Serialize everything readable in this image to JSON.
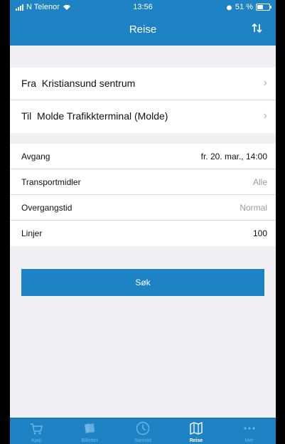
{
  "status_bar": {
    "carrier": "N Telenor",
    "time": "13:56",
    "battery": "51 %"
  },
  "nav": {
    "title": "Reise",
    "swap_icon": "swap-arrows-icon"
  },
  "route": {
    "from_prefix": "Fra",
    "from_value": "Kristiansund sentrum",
    "to_prefix": "Til",
    "to_value": "Molde Trafikkterminal (Molde)"
  },
  "options": [
    {
      "label": "Avgang",
      "value": "fr. 20. mar., 14:00"
    },
    {
      "label": "Transportmidler",
      "value": "Alle"
    },
    {
      "label": "Overgangstid",
      "value": "Normal"
    },
    {
      "label": "Linjer",
      "value": "100"
    }
  ],
  "search_button": "Søk",
  "tabs": [
    {
      "label": "Kjøp",
      "icon": "cart-icon"
    },
    {
      "label": "Billetter",
      "icon": "tickets-icon"
    },
    {
      "label": "Sanntid",
      "icon": "clock-icon"
    },
    {
      "label": "Reise",
      "icon": "map-icon"
    },
    {
      "label": "Mer",
      "icon": "more-icon"
    }
  ],
  "active_tab": "Reise",
  "colors": {
    "brand": "#1e83c4",
    "background": "#efeff4",
    "inactive_tab": "#6fb6e3"
  }
}
